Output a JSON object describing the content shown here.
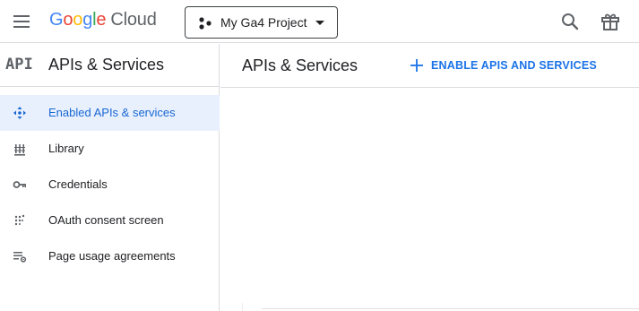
{
  "header": {
    "logo": {
      "google_letters": [
        "G",
        "o",
        "o",
        "g",
        "l",
        "e"
      ],
      "google_colors": [
        "#4285F4",
        "#EA4335",
        "#FBBC04",
        "#4285F4",
        "#34A853",
        "#EA4335"
      ],
      "product": "Cloud"
    },
    "project_picker": {
      "label": "My Ga4 Project"
    },
    "icons": {
      "menu": "hamburger-menu-icon",
      "search": "search-icon",
      "gift": "gift-icon"
    }
  },
  "sidebar": {
    "badge": "API",
    "title": "APIs & Services",
    "items": [
      {
        "label": "Enabled APIs & services",
        "icon": "enabled-apis-icon",
        "active": true
      },
      {
        "label": "Library",
        "icon": "library-icon",
        "active": false
      },
      {
        "label": "Credentials",
        "icon": "key-icon",
        "active": false
      },
      {
        "label": "OAuth consent screen",
        "icon": "oauth-consent-icon",
        "active": false
      },
      {
        "label": "Page usage agreements",
        "icon": "page-usage-settings-icon",
        "active": false
      }
    ]
  },
  "main": {
    "title": "APIs & Services",
    "enable_button": "ENABLE APIS AND SERVICES"
  },
  "colors": {
    "accent": "#1a73e8",
    "active_bg": "#e8f0fe",
    "active_text": "#1967d2",
    "icon_gray": "#5f6368",
    "divider": "#dadce0"
  }
}
